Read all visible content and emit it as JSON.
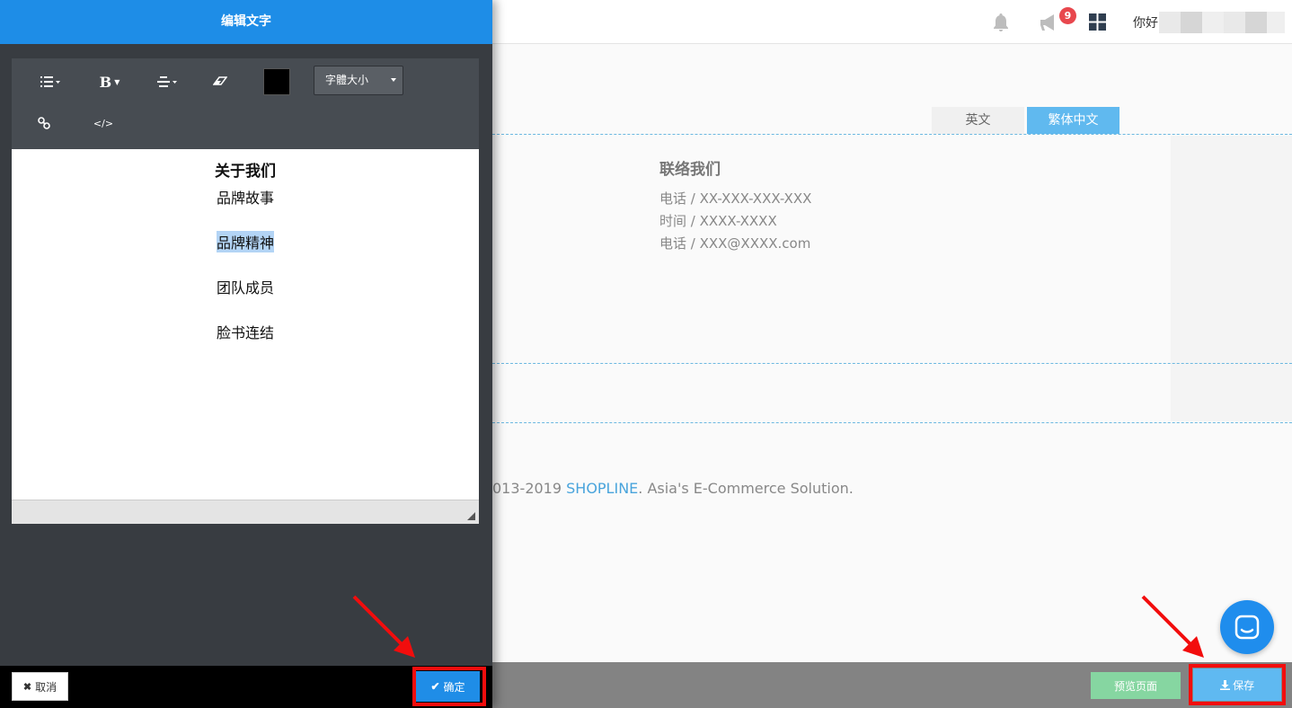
{
  "panel": {
    "title": "编辑文字",
    "toolbar": {
      "list_icon": "list-icon",
      "bold_label": "B",
      "align_icon": "align-icon",
      "eraser_icon": "eraser-icon",
      "color": "#000000",
      "font_size_label": "字體大小",
      "link_icon": "link-icon",
      "code_label": "</>"
    },
    "editor": {
      "title": "关于我们",
      "items": [
        "品牌故事",
        "品牌精神",
        "团队成员",
        "脸书连结"
      ],
      "selected_index": 1
    },
    "cancel_label": "取消",
    "confirm_label": "确定"
  },
  "header": {
    "notification_count": "9",
    "greeting": "你好"
  },
  "main": {
    "tabs": [
      {
        "label": "英文",
        "active": false
      },
      {
        "label": "繁体中文",
        "active": true
      }
    ],
    "contact": {
      "title": "联络我们",
      "lines": [
        "电话 / XX-XXX-XXX-XXX",
        "时间 / XXXX-XXXX",
        "电话 / XXX@XXXX.com"
      ]
    },
    "footer": {
      "prefix": "013-2019 ",
      "brand": "SHOPLINE",
      "suffix": ". Asia's E-Commerce Solution."
    }
  },
  "actions": {
    "preview_label": "预览页面",
    "save_label": "保存"
  },
  "colors": {
    "primary": "#1e8de7",
    "tab_active": "#60b9ef",
    "preview_green": "#86d6a1",
    "highlight_red": "#f20d0d",
    "badge_red": "#e8474d"
  }
}
